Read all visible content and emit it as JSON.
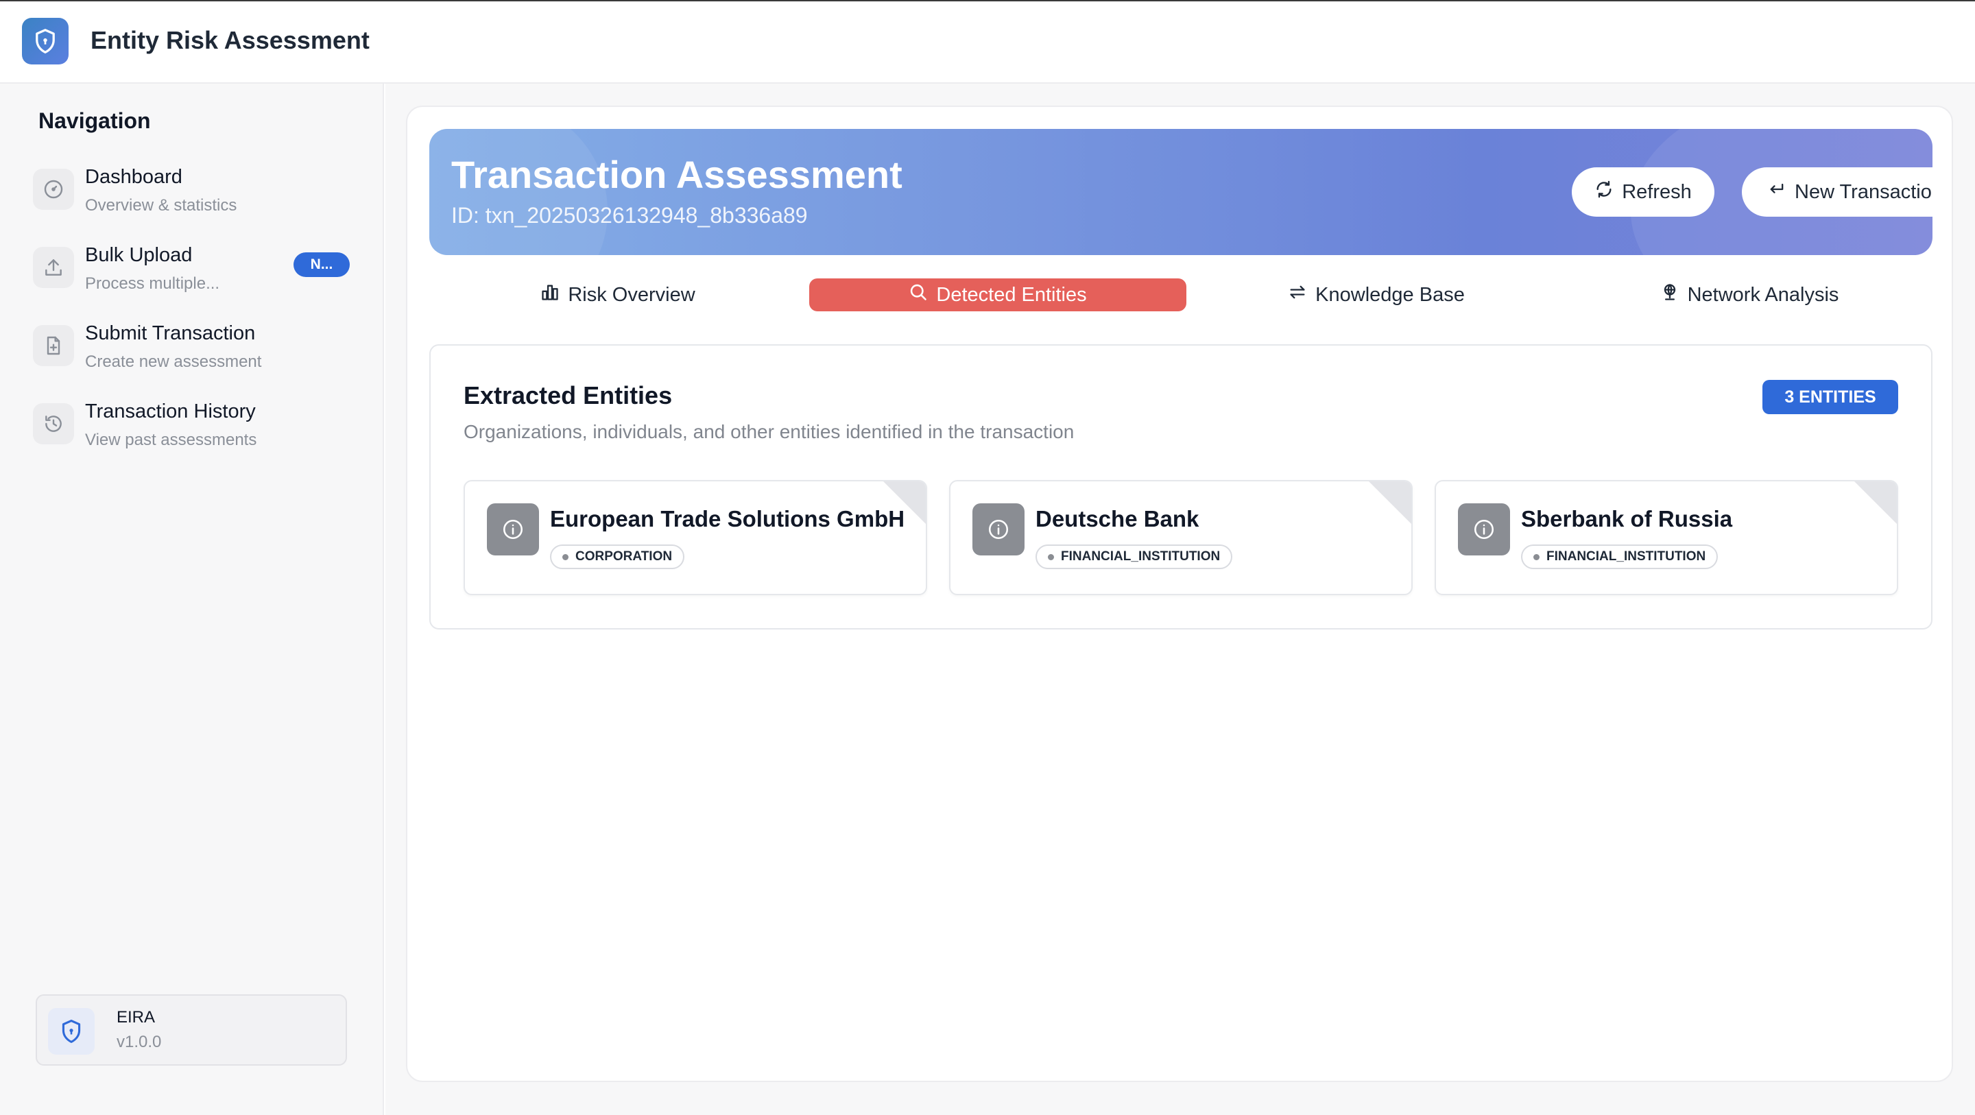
{
  "app": {
    "title": "Entity Risk Assessment",
    "logo_icon": "shield-icon"
  },
  "sidebar": {
    "heading": "Navigation",
    "items": [
      {
        "label": "Dashboard",
        "sub": "Overview & statistics",
        "icon": "gauge-icon"
      },
      {
        "label": "Bulk Upload",
        "sub": "Process multiple...",
        "icon": "upload-icon",
        "badge": "N..."
      },
      {
        "label": "Submit Transaction",
        "sub": "Create new assessment",
        "icon": "file-plus-icon"
      },
      {
        "label": "Transaction History",
        "sub": "View past assessments",
        "icon": "history-icon"
      }
    ],
    "version": {
      "name": "EIRA",
      "number": "v1.0.0",
      "icon": "shield-icon"
    }
  },
  "hero": {
    "title": "Transaction Assessment",
    "id_text": "ID: txn_20250326132948_8b336a89",
    "refresh_label": "Refresh",
    "new_transaction_label": "New Transaction"
  },
  "tabs": [
    {
      "label": "Risk Overview",
      "icon": "bar-chart-icon",
      "active": false
    },
    {
      "label": "Detected Entities",
      "icon": "search-icon",
      "active": true
    },
    {
      "label": "Knowledge Base",
      "icon": "swap-arrows-icon",
      "active": false
    },
    {
      "label": "Network Analysis",
      "icon": "network-globe-icon",
      "active": false
    }
  ],
  "entities": {
    "title": "Extracted Entities",
    "subtitle": "Organizations, individuals, and other entities identified in the transaction",
    "count_label": "3 ENTITIES",
    "items": [
      {
        "name": "European Trade Solutions GmbH",
        "type": "CORPORATION"
      },
      {
        "name": "Deutsche Bank",
        "type": "FINANCIAL_INSTITUTION"
      },
      {
        "name": "Sberbank of Russia",
        "type": "FINANCIAL_INSTITUTION"
      }
    ]
  },
  "colors": {
    "accent_blue": "#2f6ad9",
    "active_tab": "#e5605a",
    "hero_gradient_start": "#84aee7",
    "hero_gradient_end": "#7a84da"
  }
}
